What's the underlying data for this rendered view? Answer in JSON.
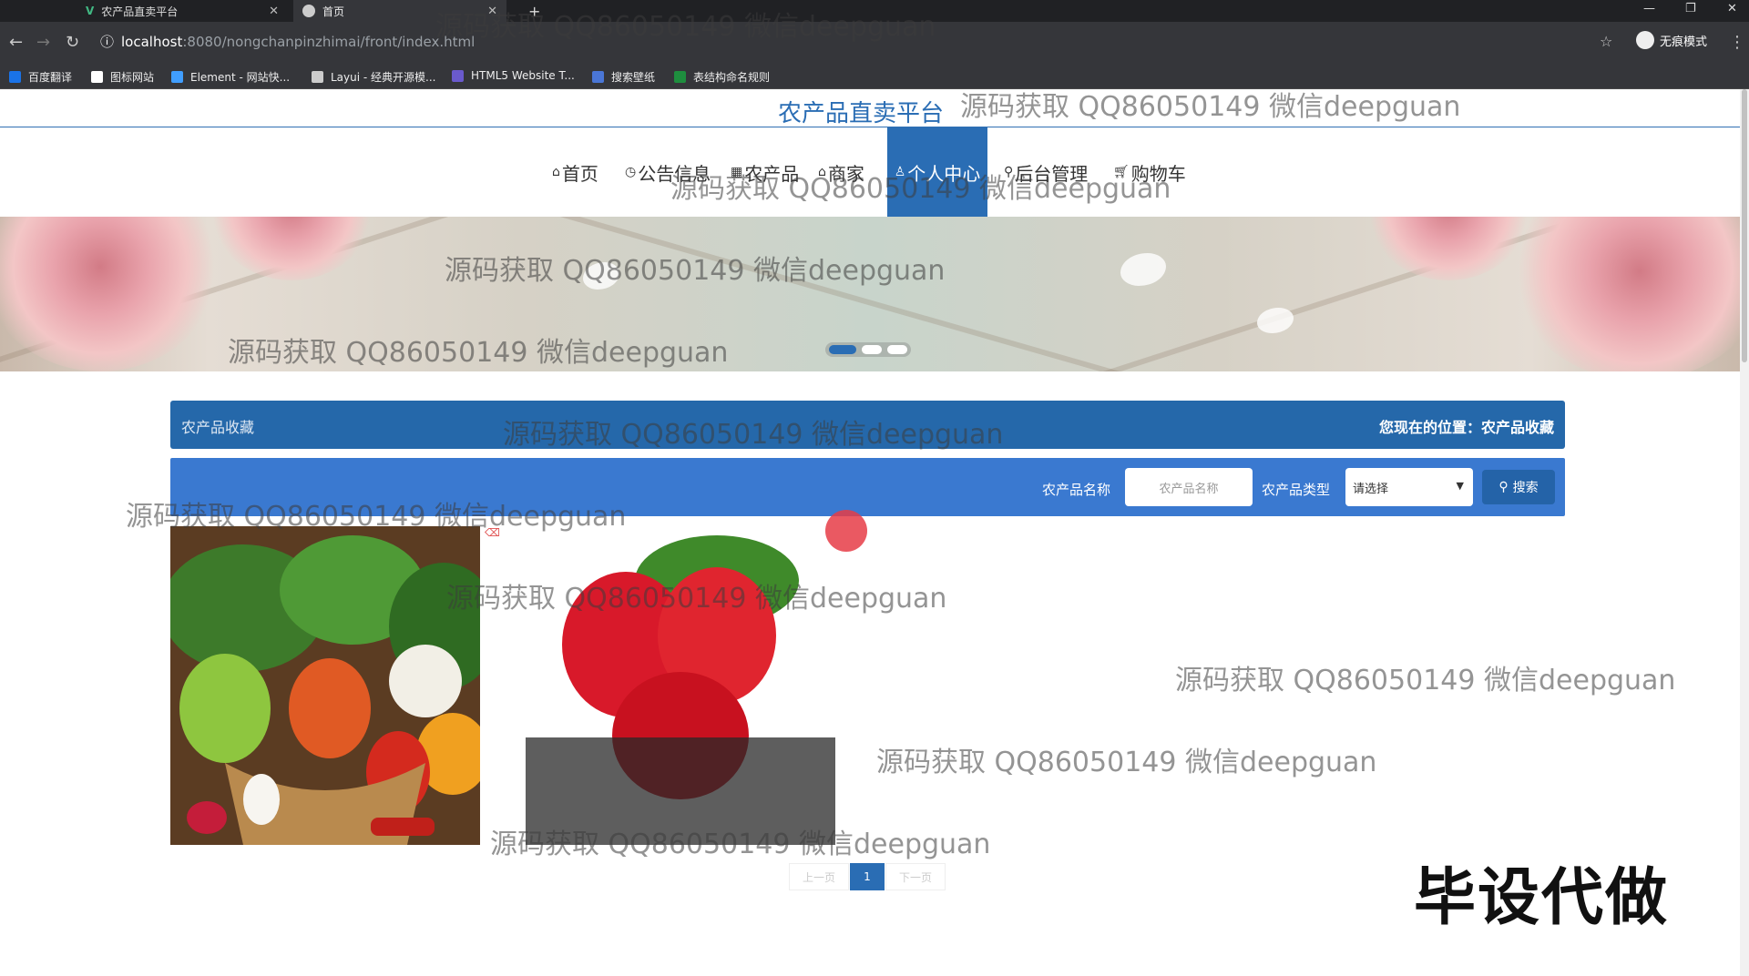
{
  "browser": {
    "tabs": [
      {
        "title": "农产品直卖平台"
      },
      {
        "title": "首页"
      }
    ],
    "new_tab": "+",
    "url_host": "localhost",
    "url_rest": ":8080/nongchanpinzhimai/front/index.html",
    "incognito_label": "无痕模式",
    "bookmarks": [
      {
        "label": "百度翻译"
      },
      {
        "label": "图标网站"
      },
      {
        "label": "Element - 网站快..."
      },
      {
        "label": "Layui - 经典开源模..."
      },
      {
        "label": "HTML5 Website T..."
      },
      {
        "label": "搜索壁纸"
      },
      {
        "label": "表结构命名规则"
      }
    ]
  },
  "site": {
    "title": "农产品直卖平台",
    "menu": [
      {
        "label": "首页",
        "icon": "home-icon"
      },
      {
        "label": "公告信息",
        "icon": "clock-icon"
      },
      {
        "label": "农产品",
        "icon": "grid-icon"
      },
      {
        "label": "商家",
        "icon": "store-icon"
      },
      {
        "label": "个人中心",
        "icon": "user-icon",
        "active": true
      },
      {
        "label": "后台管理",
        "icon": "link-icon"
      },
      {
        "label": "购物车",
        "icon": "cart-icon"
      }
    ]
  },
  "page": {
    "section_title": "农产品收藏",
    "location_label": "您现在的位置：",
    "location_value": "农产品收藏",
    "filter": {
      "name_label": "农产品名称",
      "name_placeholder": "农产品名称",
      "type_label": "农产品类型",
      "type_selected": "请选择",
      "search_button": "搜索"
    },
    "pagination": {
      "prev": "上一页",
      "current": "1",
      "next": "下一页"
    }
  },
  "overlay": {
    "stamp": "毕设代做",
    "watermark": "源码获取 QQ86050149 微信deepguan"
  },
  "colors": {
    "primary": "#2a6db4",
    "bar_dark": "#2568aa",
    "bar_light": "#3a79d0"
  }
}
